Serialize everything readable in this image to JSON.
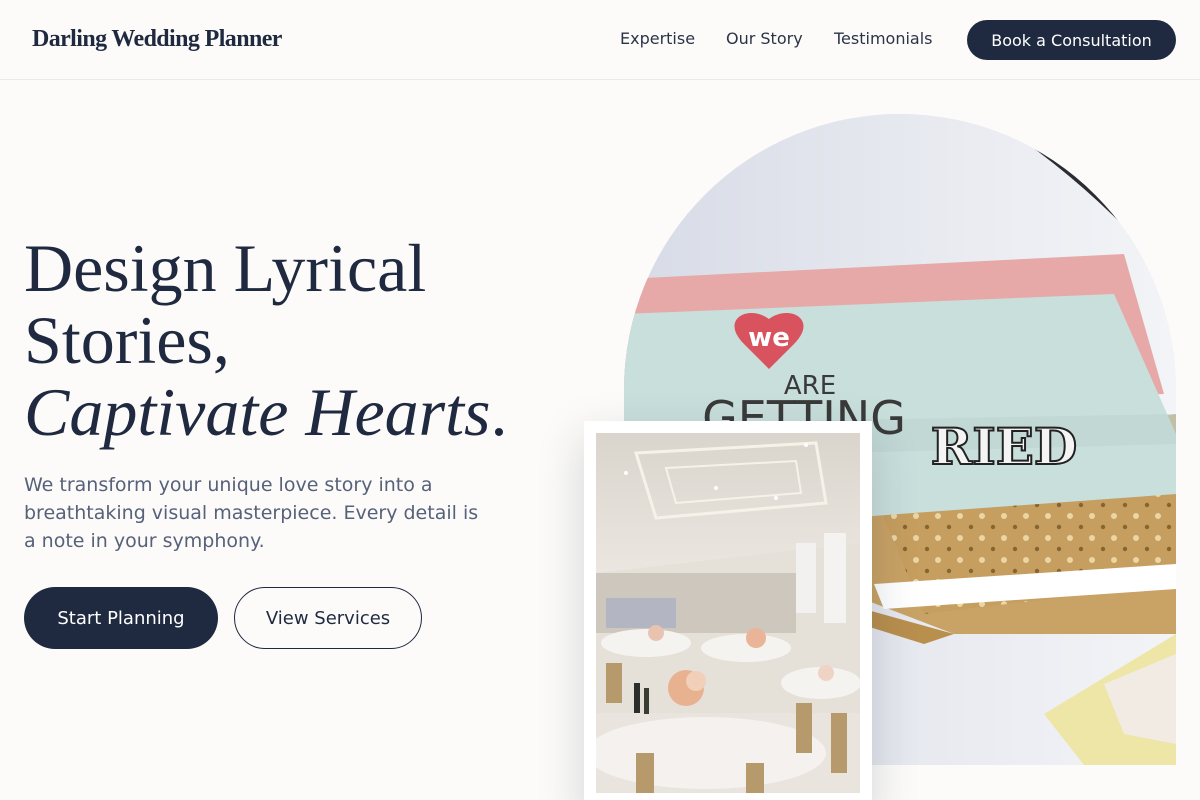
{
  "brand": {
    "name": "Darling Wedding Planner"
  },
  "nav": {
    "links": [
      "Expertise",
      "Our Story",
      "Testimonials"
    ],
    "cta_label": "Book a Consultation"
  },
  "hero": {
    "title_line1": "Design Lyrical",
    "title_line2": "Stories,",
    "title_line3_italic": "Captivate Hearts",
    "title_line3_punct": ".",
    "subtitle": "We transform your unique love story into a breathtaking visual masterpiece. Every detail is a note in your symphony.",
    "primary_button": "Start Planning",
    "secondary_button": "View Services"
  },
  "images": {
    "arch_photo": {
      "card_heart_text": "we",
      "card_line2": "ARE",
      "card_line3": "GETTING",
      "card_line4": "RIED"
    },
    "framed_photo": "banquet-hall-photo"
  },
  "colors": {
    "primary": "#1f2a40",
    "background": "#fcfbf9",
    "muted_text": "#56617a",
    "card_mint": "#c9dfdc",
    "card_pink": "#e6a9a8",
    "heart_red": "#d9535e",
    "envelope_gold": "#c9a265"
  }
}
